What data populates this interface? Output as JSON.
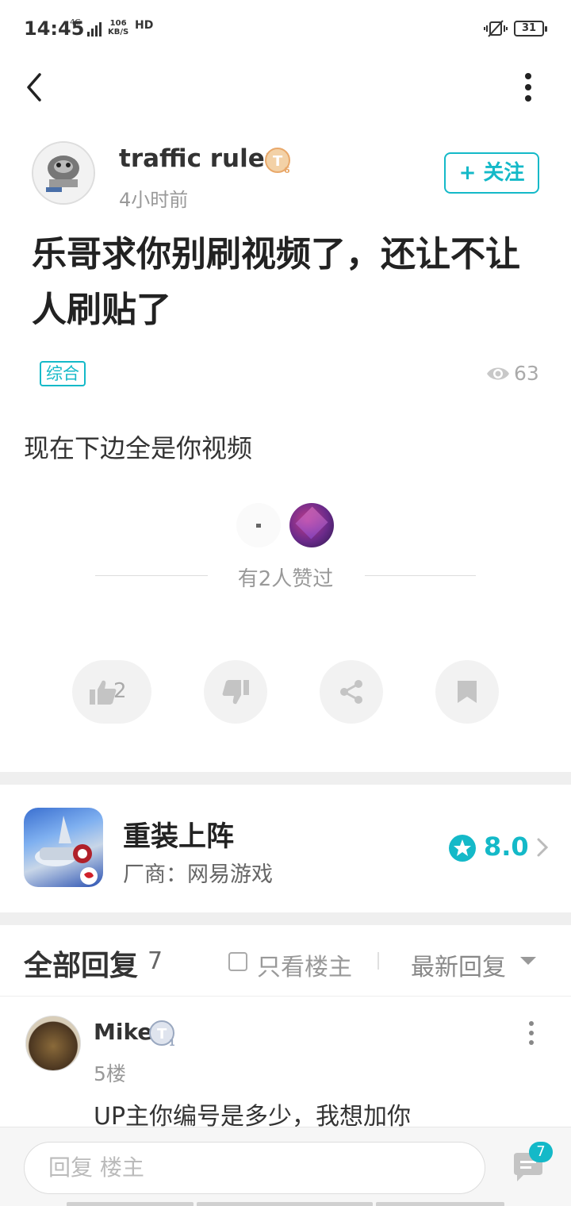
{
  "status_bar": {
    "time": "14:45",
    "network": "4G",
    "speed_value": "106",
    "speed_unit": "KB/S",
    "hd": "HD",
    "battery": "31"
  },
  "author": {
    "name": "traffic ruler",
    "time_ago": "4小时前",
    "badge_level": "6",
    "follow_label": "+ 关注"
  },
  "post": {
    "title": "乐哥求你别刷视频了，还让不让人刷贴了",
    "tag": "综合",
    "views": "63",
    "body": "现在下边全是你视频",
    "liked_text": "有2人赞过",
    "like_count": "2"
  },
  "game": {
    "name": "重装上阵",
    "vendor": "厂商：网易游戏",
    "score": "8.0"
  },
  "replies_header": {
    "title": "全部回复",
    "count": "7",
    "only_op": "只看楼主",
    "sort": "最新回复"
  },
  "reply": {
    "name": "Mike",
    "badge_level": "1",
    "floor": "5楼",
    "text": "UP主你编号是多少，我想加你"
  },
  "bottom_bar": {
    "placeholder": "回复  楼主",
    "comment_count": "7"
  },
  "colors": {
    "accent": "#14b9c8",
    "gold_badge": "#e9a86a",
    "silver_badge": "#9aa8c0"
  },
  "icons": [
    "back-icon",
    "more-vertical-icon",
    "eye-icon",
    "thumbs-up-icon",
    "thumbs-down-icon",
    "share-icon",
    "bookmark-icon",
    "star-icon",
    "chevron-right-icon",
    "comment-icon"
  ]
}
